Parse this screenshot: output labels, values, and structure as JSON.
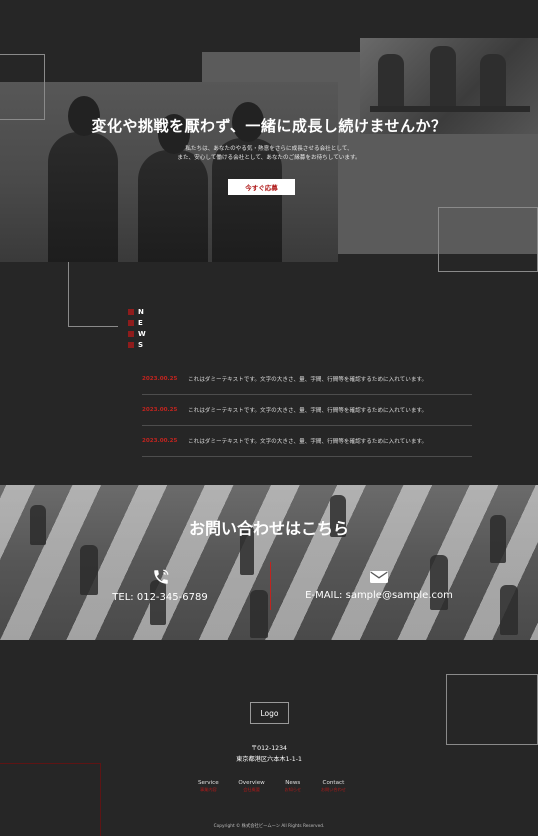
{
  "hero": {
    "title": "変化や挑戦を厭わず、一緒に成長し続けませんか？",
    "sub_line1": "私たちは、あなたのやる気・熱意をさらに成長させる会社として、",
    "sub_line2": "また、安心して働ける会社として、あなたのご縁募をお待ちしています。",
    "apply_label": "今すぐ応募"
  },
  "news": {
    "heading_letters": [
      "N",
      "E",
      "W",
      "S"
    ],
    "items": [
      {
        "date": "2023.00.25",
        "text": "これはダミーテキストです。文字の大きさ、量、字間、行間等を確認するために入れています。"
      },
      {
        "date": "2023.00.25",
        "text": "これはダミーテキストです。文字の大きさ、量、字間、行間等を確認するために入れています。"
      },
      {
        "date": "2023.00.25",
        "text": "これはダミーテキストです。文字の大きさ、量、字間、行間等を確認するために入れています。"
      }
    ]
  },
  "contact": {
    "title": "お問い合わせはこちら",
    "tel": "TEL: 012-345-6789",
    "email": "E-MAIL: sample@sample.com"
  },
  "footer": {
    "logo": "Logo",
    "postal": "〒012-1234",
    "address": "東京都港区六本木1-1-1",
    "nav": [
      {
        "label": "Service",
        "sub": "事業内容"
      },
      {
        "label": "Overview",
        "sub": "会社概要"
      },
      {
        "label": "News",
        "sub": "お知らせ"
      },
      {
        "label": "Contact",
        "sub": "お問い合わせ"
      }
    ],
    "copyright": "Copyright © 株式会社ビームーン All Rights Reserved."
  },
  "colors": {
    "accent": "#c0241f",
    "background": "#262626"
  },
  "icons": [
    "phone-icon",
    "envelope-icon"
  ]
}
